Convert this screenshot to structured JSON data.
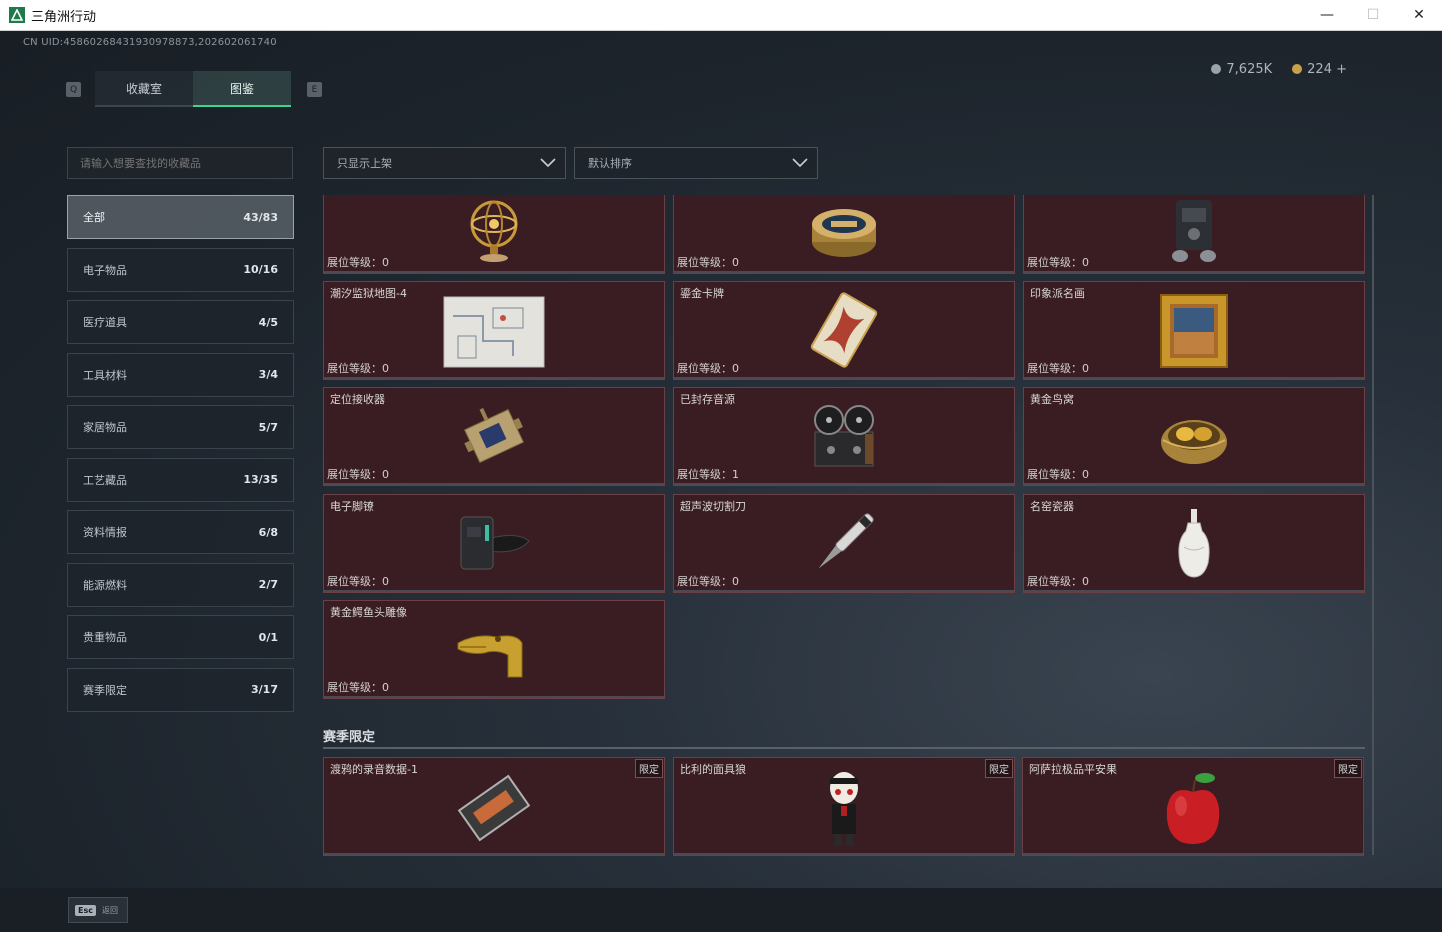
{
  "window": {
    "title": "三角洲行动",
    "minimize": "—",
    "maximize": "☐",
    "close": "✕"
  },
  "uid_text": "CN UID:45860268431930978873,202602061740",
  "currency": {
    "silver": "7,625K",
    "gold": "224 +"
  },
  "keys": {
    "prev": "Q",
    "next": "E"
  },
  "tabs": [
    {
      "label": "收藏室",
      "active": false
    },
    {
      "label": "图鉴",
      "active": true
    }
  ],
  "search": {
    "placeholder": "请输入想要查找的收藏品"
  },
  "categories": [
    {
      "label": "全部",
      "count": "43/83",
      "active": true
    },
    {
      "label": "电子物品",
      "count": "10/16"
    },
    {
      "label": "医疗道具",
      "count": "4/5"
    },
    {
      "label": "工具材料",
      "count": "3/4"
    },
    {
      "label": "家居物品",
      "count": "5/7"
    },
    {
      "label": "工艺藏品",
      "count": "13/35"
    },
    {
      "label": "资料情报",
      "count": "6/8"
    },
    {
      "label": "能源燃料",
      "count": "2/7"
    },
    {
      "label": "贵重物品",
      "count": "0/1"
    },
    {
      "label": "赛季限定",
      "count": "3/17"
    }
  ],
  "filters": {
    "shelf": "只显示上架",
    "sort": "默认排序"
  },
  "items": [
    {
      "name": "",
      "level_label": "展位等级：",
      "level": "0",
      "icon": "armillary-sphere-icon"
    },
    {
      "name": "",
      "level_label": "展位等级：",
      "level": "0",
      "icon": "caviar-tin-icon"
    },
    {
      "name": "",
      "level_label": "展位等级：",
      "level": "0",
      "icon": "machine-icon"
    },
    {
      "name": "潮汐监狱地图-4",
      "level_label": "展位等级：",
      "level": "0",
      "icon": "map-icon"
    },
    {
      "name": "鎏金卡牌",
      "level_label": "展位等级：",
      "level": "0",
      "icon": "card-icon"
    },
    {
      "name": "印象派名画",
      "level_label": "展位等级：",
      "level": "0",
      "icon": "painting-icon"
    },
    {
      "name": "定位接收器",
      "level_label": "展位等级：",
      "level": "0",
      "icon": "receiver-icon"
    },
    {
      "name": "已封存音源",
      "level_label": "展位等级：",
      "level": "1",
      "icon": "reel-recorder-icon"
    },
    {
      "name": "黄金鸟窝",
      "level_label": "展位等级：",
      "level": "0",
      "icon": "golden-nest-icon"
    },
    {
      "name": "电子脚镣",
      "level_label": "展位等级：",
      "level": "0",
      "icon": "ankle-monitor-icon"
    },
    {
      "name": "超声波切割刀",
      "level_label": "展位等级：",
      "level": "0",
      "icon": "cutter-icon"
    },
    {
      "name": "名窑瓷器",
      "level_label": "展位等级：",
      "level": "0",
      "icon": "porcelain-vase-icon"
    },
    {
      "name": "黄金鳄鱼头雕像",
      "level_label": "展位等级：",
      "level": "0",
      "icon": "golden-crocodile-icon"
    }
  ],
  "season_section": {
    "title": "赛季限定",
    "items": [
      {
        "name": "渡鸦的录音数据-1",
        "badge": "限定",
        "icon": "tape-icon"
      },
      {
        "name": "比利的面具狼",
        "badge": "限定",
        "icon": "puppet-doll-icon"
      },
      {
        "name": "阿萨拉极品平安果",
        "badge": "限定",
        "icon": "red-apple-icon"
      }
    ]
  },
  "bottom": {
    "esc_key": "Esc",
    "esc_label": "返回"
  }
}
